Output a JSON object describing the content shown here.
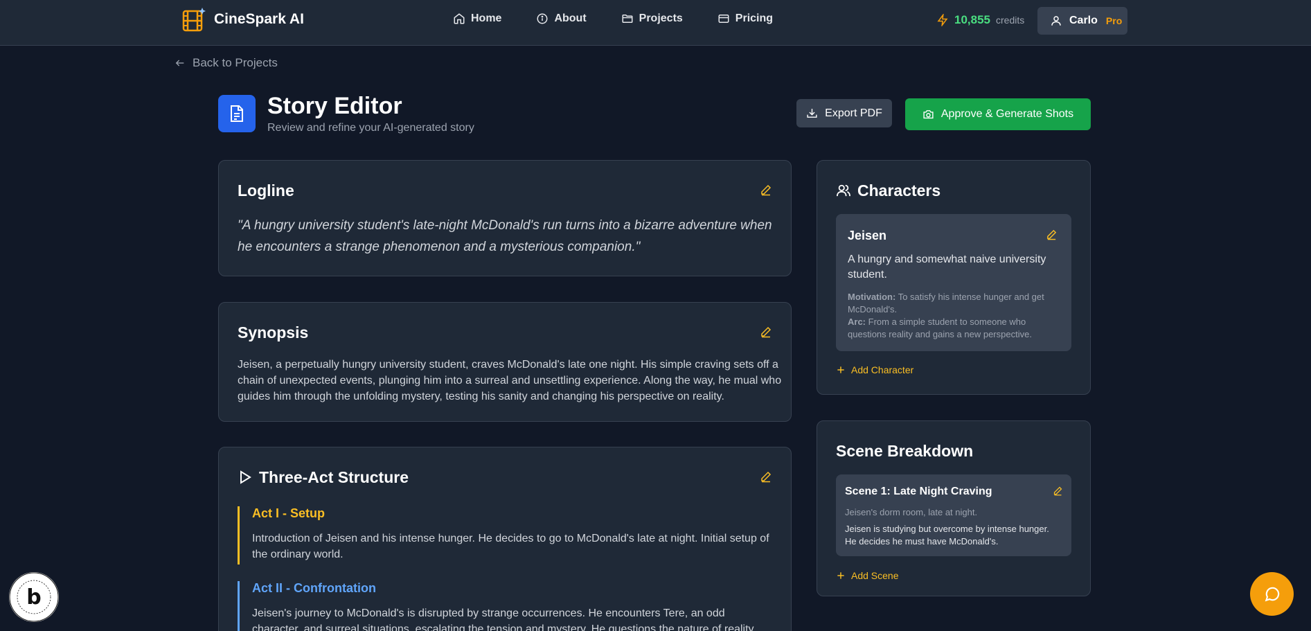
{
  "brand": {
    "name": "CineSpark AI",
    "icon": "film-sparkle-icon",
    "color": "#f59e0b"
  },
  "nav": {
    "items": [
      {
        "label": "Home",
        "icon": "home-icon"
      },
      {
        "label": "About",
        "icon": "info-icon"
      },
      {
        "label": "Projects",
        "icon": "folder-icon"
      },
      {
        "label": "Pricing",
        "icon": "credit-card-icon"
      }
    ]
  },
  "credits": {
    "value": "10,855",
    "label": "credits",
    "icon": "lightning-icon"
  },
  "user": {
    "name": "Carlo",
    "plan": "Pro",
    "icon": "user-icon"
  },
  "back": {
    "label": "Back to Projects"
  },
  "header": {
    "title": "Story Editor",
    "subtitle": "Review and refine your AI-generated story",
    "export_label": "Export PDF",
    "approve_label": "Approve & Generate Shots"
  },
  "logline": {
    "title": "Logline",
    "text": "\"A hungry university student's late-night McDonald's run turns into a bizarre adventure when he encounters a strange phenomenon and a mysterious companion.\""
  },
  "synopsis": {
    "title": "Synopsis",
    "text": "Jeisen, a perpetually hungry university student, craves McDonald's late one night. His simple craving sets off a chain of unexpected events, plunging him into a surreal and unsettling experience. Along the way, he mual who guides him through the unfolding mystery, testing his sanity and changing his perspective on reality."
  },
  "structure": {
    "title": "Three-Act Structure",
    "acts": [
      {
        "title": "Act I - Setup",
        "color": "#fbbf24",
        "text": "Introduction of Jeisen and his intense hunger. He decides to go to McDonald's late at night. Initial setup of the ordinary world."
      },
      {
        "title": "Act II - Confrontation",
        "color": "#60a5fa",
        "text": "Jeisen's journey to McDonald's is disrupted by strange occurrences. He encounters Tere, an odd character, and surreal situations, escalating the tension and mystery. He questions the nature of reality."
      }
    ]
  },
  "characters": {
    "title": "Characters",
    "items": [
      {
        "name": "Jeisen",
        "description": "A hungry and somewhat naive university student.",
        "motivation_label": "Motivation:",
        "motivation": "To satisfy his intense hunger and get McDonald's.",
        "arc_label": "Arc:",
        "arc": "From a simple student to someone who questions reality and gains a new perspective."
      }
    ],
    "add_label": "Add Character"
  },
  "scenes": {
    "title": "Scene Breakdown",
    "items": [
      {
        "title": "Scene 1: Late Night Craving",
        "location": "Jeisen's dorm room, late at night.",
        "description": "Jeisen is studying but overcome by intense hunger. He decides he must have McDonald's."
      }
    ],
    "add_label": "Add Scene"
  },
  "colors": {
    "background": "#111827",
    "surface": "#1f2937",
    "accent": "#f59e0b",
    "primary": "#2563eb",
    "success": "#16a34a"
  }
}
